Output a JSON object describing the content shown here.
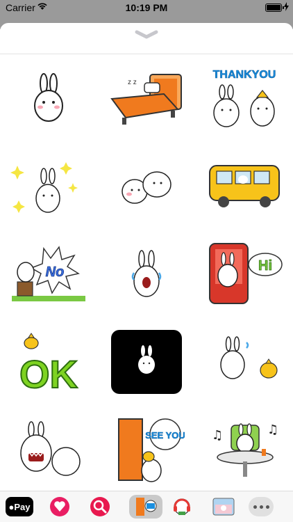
{
  "status_bar": {
    "carrier": "Carrier",
    "time": "10:19 PM",
    "battery_level": 1.0
  },
  "sticker_sheet": {
    "grabber_icon": "chevron-down-icon",
    "stickers": [
      {
        "name": "bunny-standing",
        "text": ""
      },
      {
        "name": "bunny-sleeping-in-bed",
        "text": "z z"
      },
      {
        "name": "bunny-and-chick-thankyou",
        "text": "THANKYOU"
      },
      {
        "name": "bunny-sparkles",
        "text": ""
      },
      {
        "name": "bunny-hugging-blob",
        "text": ""
      },
      {
        "name": "bunny-in-bus",
        "text": ""
      },
      {
        "name": "bunny-no-tree-stump",
        "text": "No"
      },
      {
        "name": "bunny-crying",
        "text": ""
      },
      {
        "name": "bunny-in-chair-hi",
        "text": "Hi"
      },
      {
        "name": "chick-on-ok",
        "text": "OK"
      },
      {
        "name": "bunny-on-black",
        "text": ""
      },
      {
        "name": "bunny-running-chick",
        "text": ""
      },
      {
        "name": "bunny-angry-blob",
        "text": ""
      },
      {
        "name": "bunny-door-see-you",
        "text": "SEE YOU"
      },
      {
        "name": "bunny-cafe-music",
        "text": ""
      }
    ]
  },
  "app_bar": {
    "apple_pay_label": "Pay",
    "items": [
      "apple-pay-icon",
      "digital-touch-icon",
      "image-search-icon",
      "sticker-app-icon",
      "music-sticker-app-icon",
      "photo-sticker-app-icon",
      "more-apps-icon"
    ]
  },
  "colors": {
    "thankyou_blue": "#1a8fe0",
    "no_blue": "#3b6fe0",
    "hi_green": "#7ac943",
    "ok_green": "#7ed321",
    "bed_orange": "#f07a1e",
    "chair_red": "#d8372a"
  }
}
